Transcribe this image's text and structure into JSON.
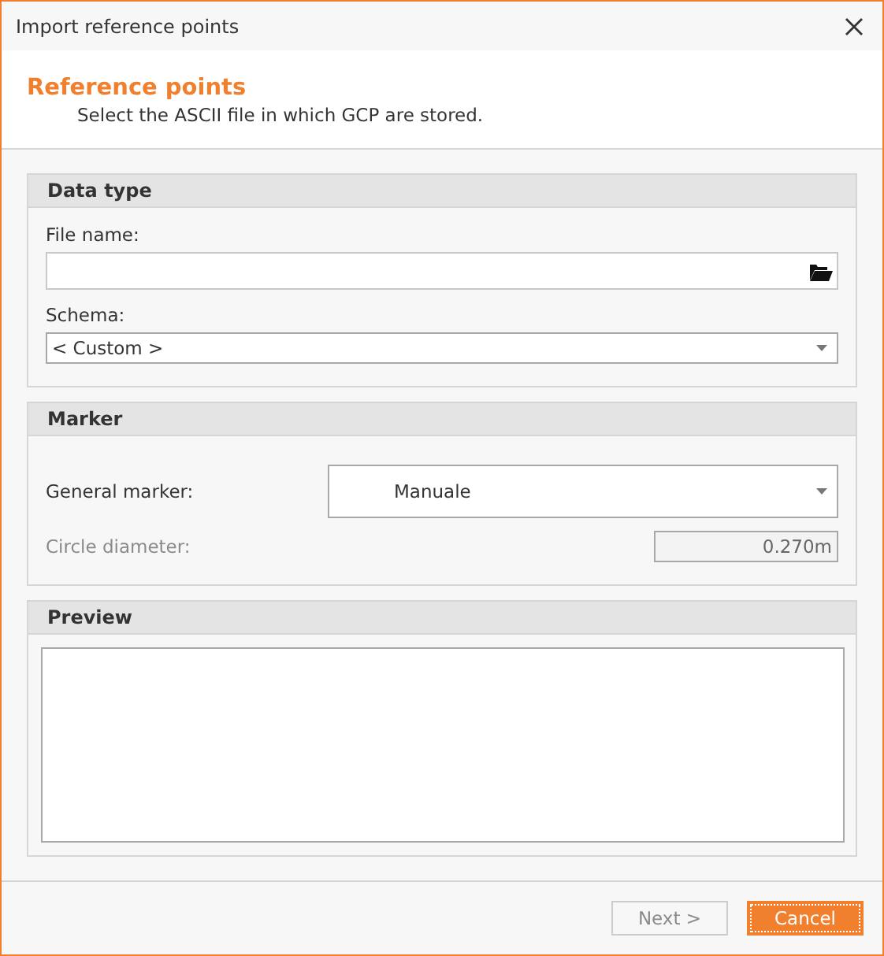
{
  "window": {
    "title": "Import reference points"
  },
  "header": {
    "title": "Reference points",
    "subtitle": "Select the ASCII file in which GCP are stored."
  },
  "data_type": {
    "title": "Data type",
    "file_name": {
      "label": "File name:"
    },
    "schema": {
      "label": "Schema:",
      "value": "< Custom >"
    }
  },
  "marker": {
    "title": "Marker",
    "general_marker": {
      "label": "General marker:",
      "value": "Manuale"
    },
    "circle_diameter": {
      "label": "Circle diameter:",
      "value": "0.270m",
      "disabled": true
    }
  },
  "preview": {
    "title": "Preview"
  },
  "buttons": [
    {
      "label": "Next >",
      "disabled": true,
      "focused": false
    },
    {
      "label": "Cancel",
      "disabled": false,
      "focused": true
    }
  ]
}
